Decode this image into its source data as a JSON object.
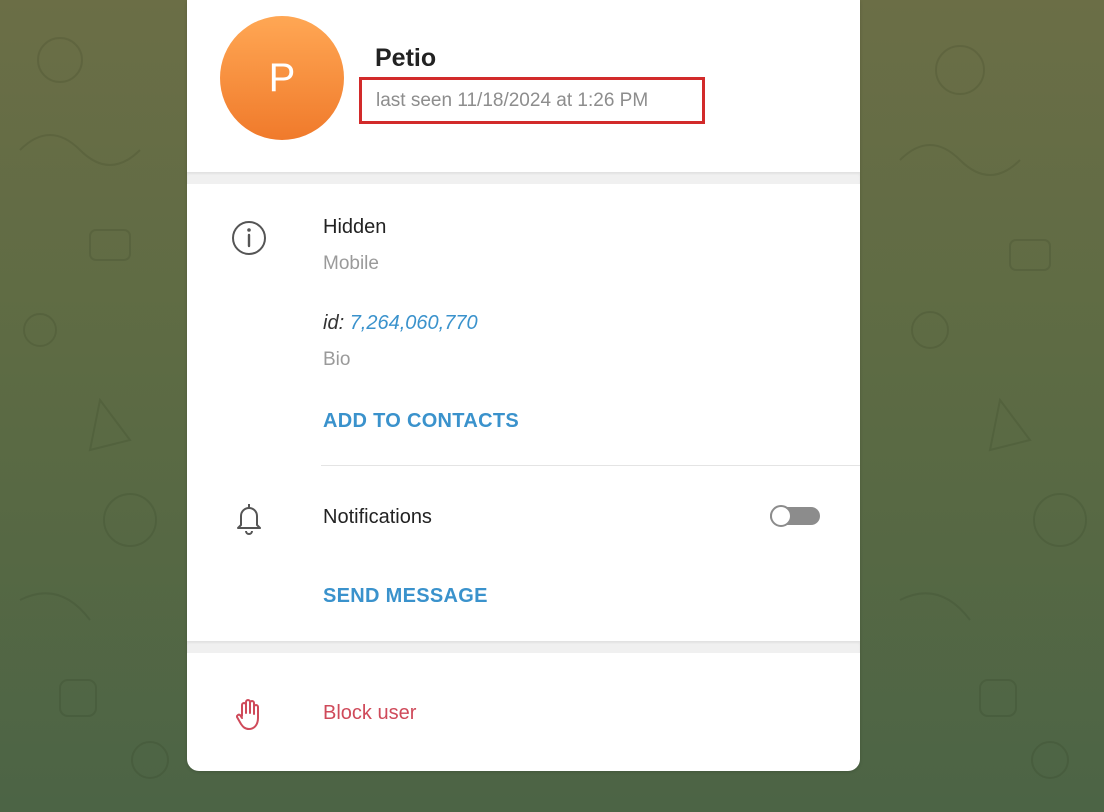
{
  "profile": {
    "avatar_initial": "P",
    "name": "Petio",
    "last_seen": "last seen 11/18/2024 at 1:26 PM"
  },
  "info": {
    "phone_value": "Hidden",
    "phone_label": "Mobile",
    "id_label": "id:",
    "id_value": "7,264,060,770",
    "bio_label": "Bio",
    "add_contacts": "ADD TO CONTACTS"
  },
  "notifications": {
    "label": "Notifications",
    "enabled": false
  },
  "send_message": "SEND MESSAGE",
  "block": {
    "label": "Block user"
  },
  "icons": {
    "info": "info-icon",
    "notifications": "bell-icon",
    "block": "hand-stop-icon"
  },
  "colors": {
    "avatar_gradient_top": "#ffa754",
    "avatar_gradient_bottom": "#f07a2b",
    "link": "#3a92cc",
    "danger": "#cf4a5a",
    "highlight_box": "#d22a2a"
  }
}
